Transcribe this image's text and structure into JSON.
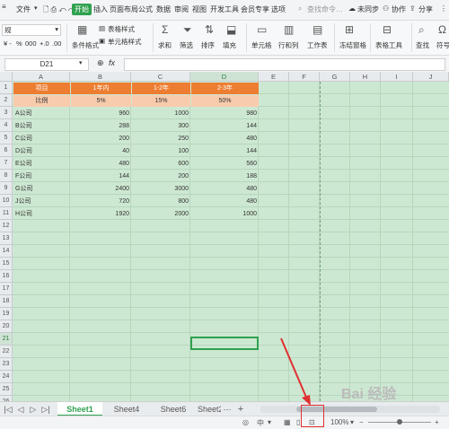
{
  "menubar": {
    "items": [
      "文件",
      "开始",
      "插入",
      "页面布局",
      "公式",
      "数据",
      "审阅",
      "视图",
      "开发工具",
      "会员专享",
      "选项"
    ],
    "search_placeholder": "查找命令…",
    "sync": "未同步",
    "collab": "协作",
    "share": "分享"
  },
  "ribbon": {
    "font_value": "规",
    "number_format": "常规",
    "number_buttons": [
      "%",
      "000",
      "+.0",
      ".00"
    ],
    "conditional_format": "条件格式",
    "table_style": "表格样式",
    "cell_style": "单元格样式",
    "sum": "求和",
    "filter": "筛选",
    "sort": "排序",
    "fill": "填充",
    "cell": "单元格",
    "row_col": "行和列",
    "worksheet": "工作表",
    "freeze": "冻结窗格",
    "table_tools": "表格工具",
    "find": "查找",
    "symbol": "符号"
  },
  "formula_bar": {
    "cell_ref": "D21",
    "fx": "fx",
    "value": ""
  },
  "sheet": {
    "columns": [
      "A",
      "B",
      "C",
      "D",
      "E",
      "F",
      "G",
      "H",
      "I",
      "J"
    ],
    "rows": [
      "1",
      "2",
      "3",
      "4",
      "5",
      "6",
      "7",
      "8",
      "9",
      "10",
      "11",
      "12",
      "13",
      "14",
      "15",
      "16",
      "17",
      "18",
      "19",
      "20",
      "21",
      "22",
      "23",
      "24",
      "25",
      "26"
    ],
    "header": [
      "项目",
      "1年内",
      "1-2年",
      "2-3年"
    ],
    "ratio": [
      "比例",
      "5%",
      "15%",
      "50%"
    ],
    "data": [
      [
        "A公司",
        "960",
        "1000",
        "980"
      ],
      [
        "B公司",
        "288",
        "300",
        "144"
      ],
      [
        "C公司",
        "200",
        "250",
        "480"
      ],
      [
        "D公司",
        "40",
        "100",
        "144"
      ],
      [
        "E公司",
        "480",
        "600",
        "560"
      ],
      [
        "F公司",
        "144",
        "200",
        "188"
      ],
      [
        "G公司",
        "2400",
        "3000",
        "480"
      ],
      [
        "J公司",
        "720",
        "800",
        "480"
      ],
      [
        "H公司",
        "1920",
        "2000",
        "1000"
      ]
    ]
  },
  "tabs": {
    "items": [
      "Sheet1",
      "Sheet4",
      "Sheet6",
      "Sheet2"
    ],
    "active": "Sheet1",
    "add": "+"
  },
  "status": {
    "zoom": "100%",
    "minus": "−",
    "plus": "+"
  },
  "watermark": "Bai 经验",
  "colors": {
    "accent": "#2fa14f",
    "header_fill": "#ed7d31",
    "ratio_fill": "#f8cbad",
    "grid_bg": "#cde8d2",
    "annotation": "#e03030"
  }
}
